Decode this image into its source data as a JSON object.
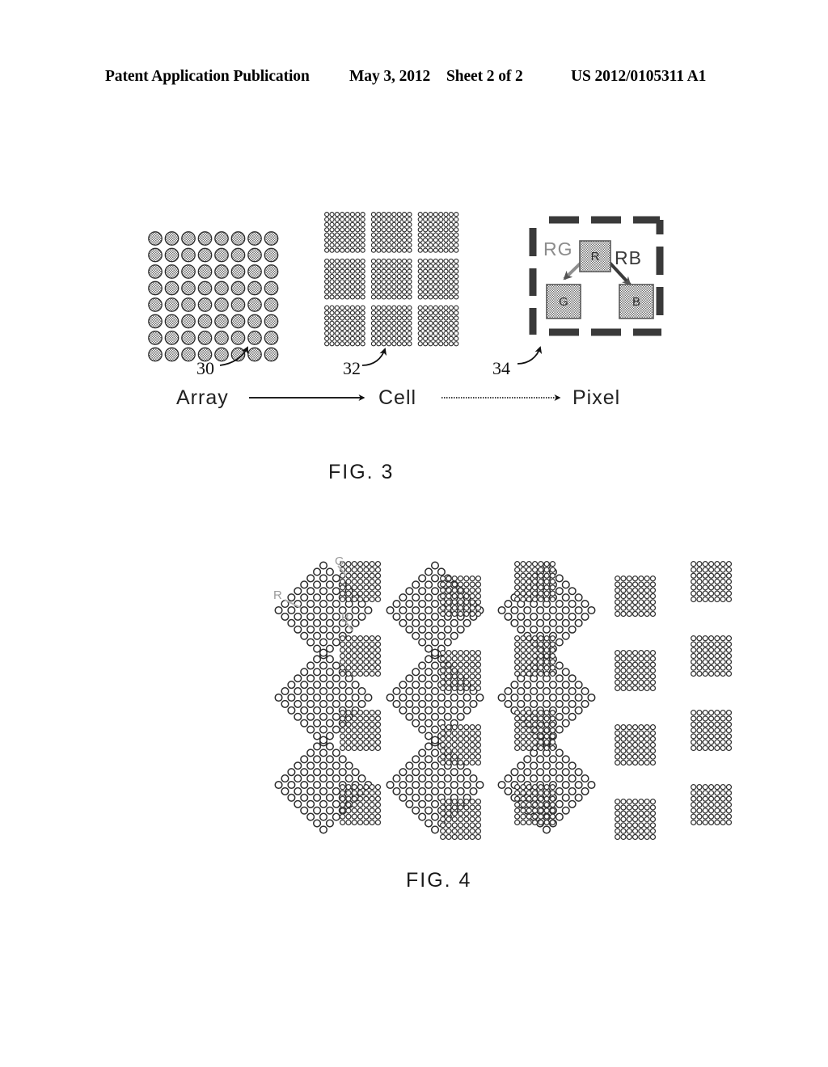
{
  "header": {
    "publication": "Patent Application Publication",
    "date": "May 3, 2012",
    "sheet": "Sheet 2 of 2",
    "document_number": "US 2012/0105311 A1"
  },
  "figures": [
    {
      "id": "fig3",
      "caption": "FIG. 3",
      "flow": [
        {
          "label": "Array",
          "ref": "30"
        },
        {
          "label": "Cell",
          "ref": "32"
        },
        {
          "label": "Pixel",
          "ref": "34"
        }
      ],
      "array_block": {
        "ref": "30",
        "rows": 8,
        "cols": 8,
        "marker": "circle"
      },
      "cell_block": {
        "ref": "32",
        "sub_rows": 3,
        "sub_cols": 3,
        "dots_per_sub_row": 8,
        "dots_per_sub_col": 8,
        "marker": "circle"
      },
      "pixel_block": {
        "ref": "34",
        "border_style": "dashed",
        "sub_pixels": [
          {
            "name": "R",
            "label": "R",
            "position": "top-center"
          },
          {
            "name": "G",
            "label": "G",
            "position": "bottom-left"
          },
          {
            "name": "B",
            "label": "B",
            "position": "bottom-right"
          }
        ],
        "pair_labels": [
          {
            "label": "RG",
            "position": "upper-left"
          },
          {
            "label": "RB",
            "position": "upper-right"
          }
        ]
      }
    },
    {
      "id": "fig4",
      "caption": "FIG. 4",
      "labels": [
        {
          "text": "R",
          "target": "rotated-diamond-grid"
        },
        {
          "text": "G",
          "target": "upper-square-grid"
        },
        {
          "text": "B",
          "target": "lower-square-grid"
        }
      ],
      "tiling": {
        "diamond_rows": 3,
        "diamond_cols": 3,
        "diamond_dots": 8,
        "square_dots": 7
      }
    }
  ],
  "colors": {
    "ink": "#000000",
    "paper": "#ffffff",
    "halftone_gray": "#6e6e6e",
    "faint_gray": "#9a9a9a"
  }
}
